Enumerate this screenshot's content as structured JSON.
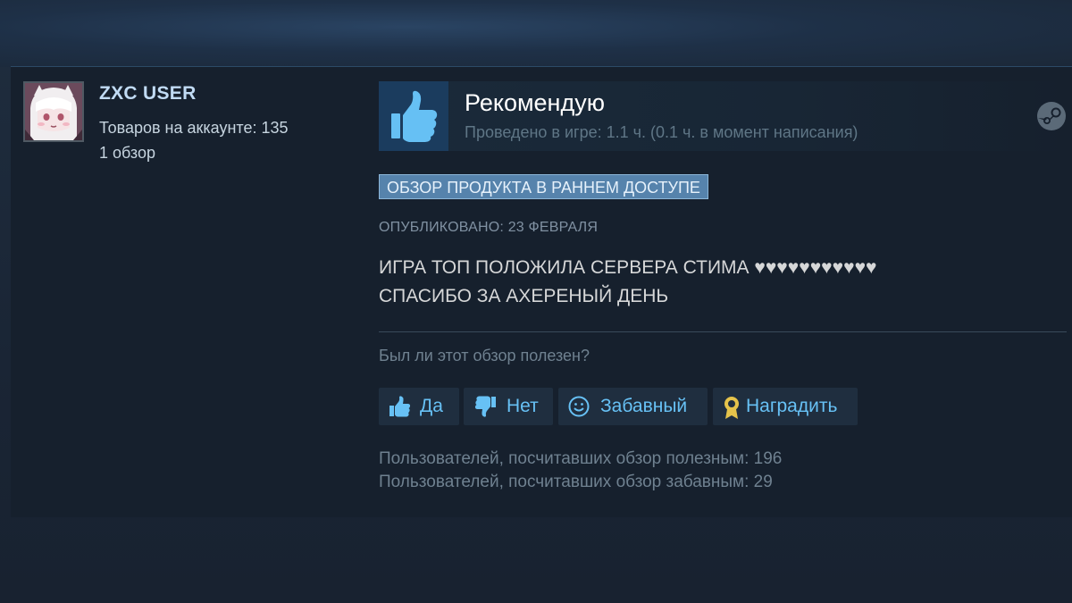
{
  "author": {
    "name": "ZXC USER",
    "products_label": "Товаров на аккаунте: 135",
    "reviews_label": "1 обзор",
    "avatar_icon": "anime-girl-avatar-icon"
  },
  "header": {
    "verdict": "Рекомендую",
    "playtime": "Проведено в игре: 1.1 ч. (0.1 ч. в момент написания)",
    "verdict_icon": "thumbs-up-icon",
    "platform_icon": "steam-icon"
  },
  "early_access_badge": "ОБЗОР ПРОДУКТА В РАННЕМ ДОСТУПЕ",
  "posted": "ОПУБЛИКОВАНО: 23 ФЕВРАЛЯ",
  "review_lines": [
    "ИГРА ТОП ПОЛОЖИЛА СЕРВЕРА СТИМА ♥♥♥♥♥♥♥♥♥♥♥",
    "СПАСИБО ЗА АХЕРЕНЫЙ ДЕНЬ"
  ],
  "helpful_question": "Был ли этот обзор полезен?",
  "buttons": {
    "yes": "Да",
    "no": "Нет",
    "funny": "Забавный",
    "award": "Наградить"
  },
  "stats": {
    "helpful": "Пользователей, посчитавших обзор полезным: 196",
    "funny": "Пользователей, посчитавших обзор забавным: 29"
  },
  "colors": {
    "link": "#67c1f5",
    "badge": "#5683ac",
    "award": "#e5c34b"
  }
}
